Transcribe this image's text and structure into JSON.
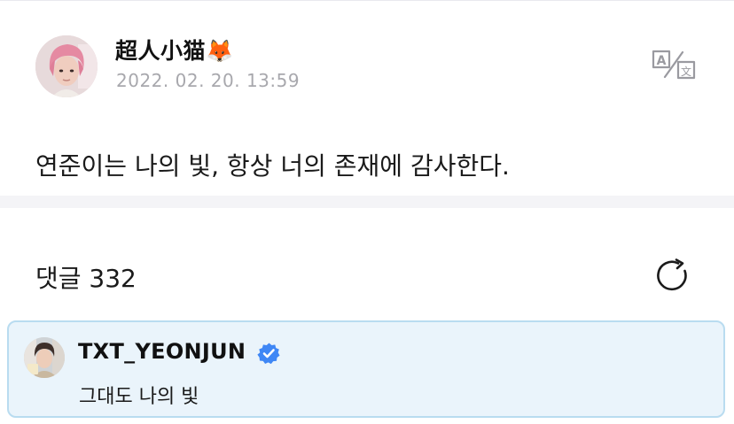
{
  "post": {
    "author": "超人小猫🦊",
    "timestamp": "2022. 02. 20. 13:59",
    "body": "연준이는 나의 빛, 항상 너의 존재에 감사한다.",
    "avatar_icon": "user-avatar-pink-hair"
  },
  "translate": {
    "icon": "translate-icon"
  },
  "comments": {
    "header": "댓글 332",
    "refresh_icon": "refresh-icon",
    "items": [
      {
        "author": "TXT_YEONJUN",
        "verified": true,
        "text": "그대도 나의 빛",
        "highlight_bg": "#eaf4fb",
        "highlight_border": "#b9dcf0"
      }
    ]
  },
  "colors": {
    "accent": "#3f87f5",
    "muted": "#a8a8ad",
    "divider": "#f4f4f7"
  }
}
